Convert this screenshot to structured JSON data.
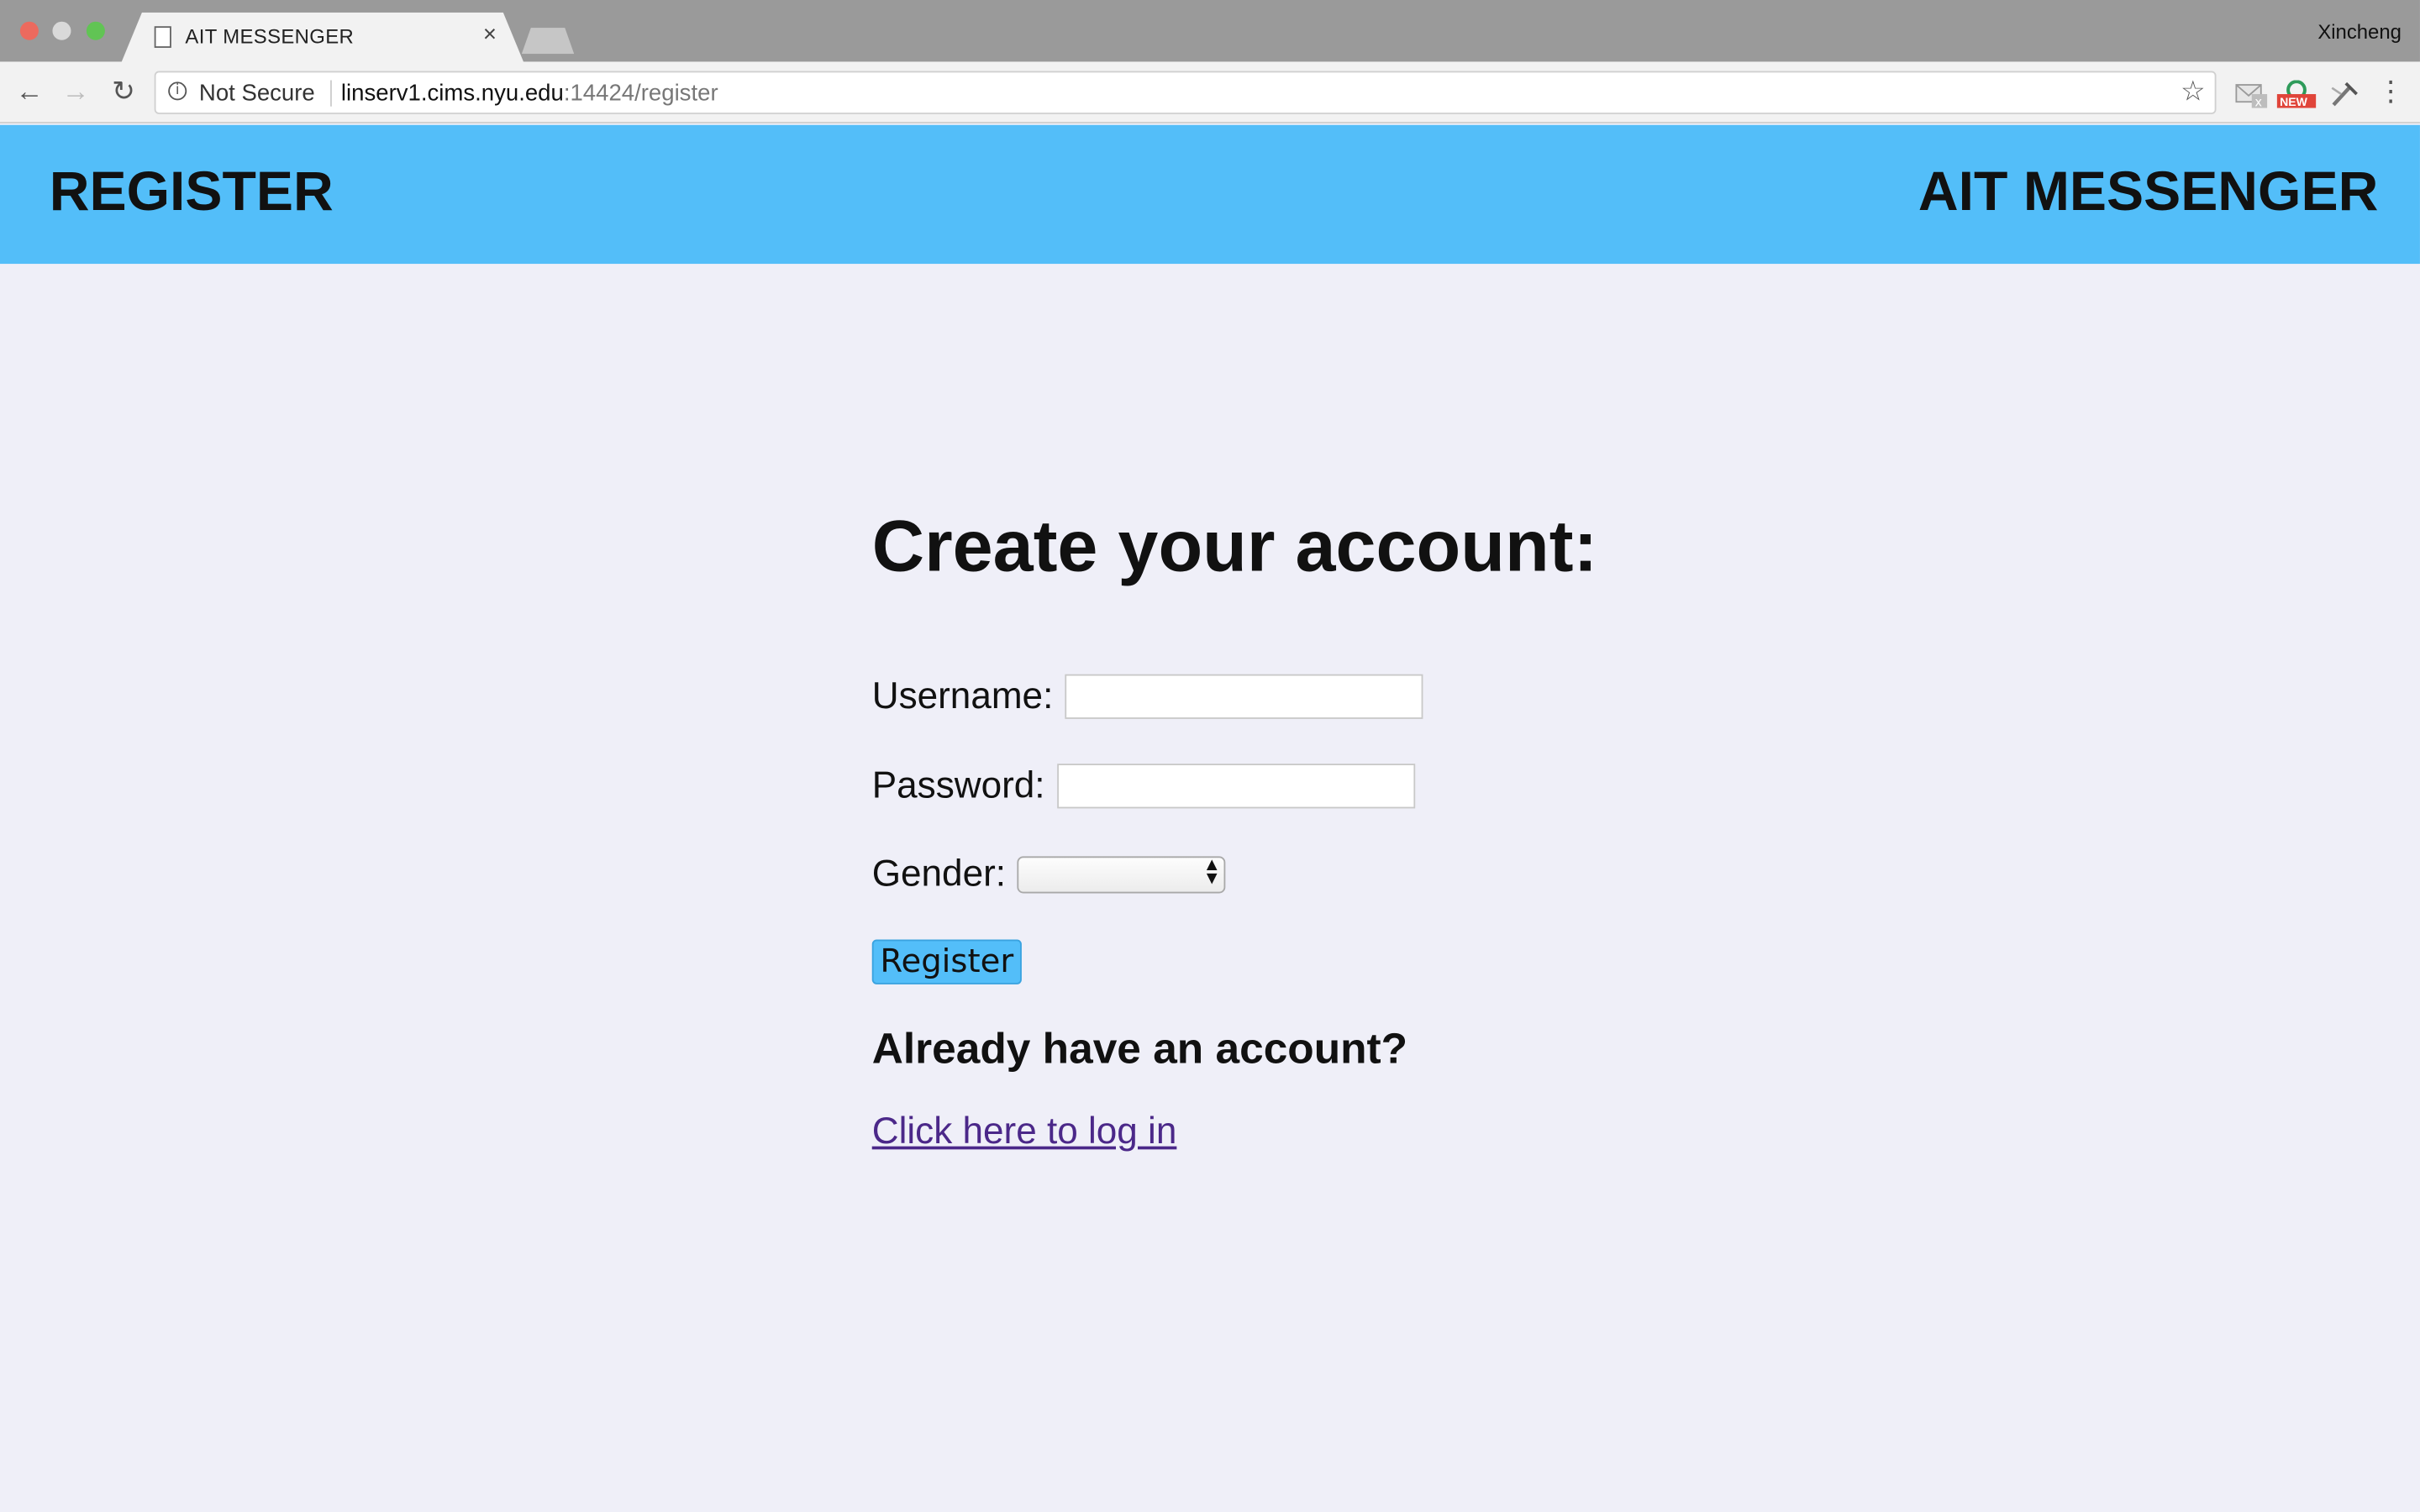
{
  "browser": {
    "tab_title": "AIT MESSENGER",
    "tab_close": "×",
    "profile_name": "Xincheng",
    "security_label": "Not Secure",
    "url_host": "linserv1.cims.nyu.edu",
    "url_rest": ":14424/register",
    "ext_new_badge": "NEW"
  },
  "header": {
    "left_title": "REGISTER",
    "right_title": "AIT MESSENGER",
    "background_color": "#53bef9"
  },
  "form": {
    "heading": "Create your account:",
    "username_label": "Username:",
    "username_value": "",
    "password_label": "Password:",
    "password_value": "",
    "gender_label": "Gender:",
    "gender_selected": "",
    "submit_label": "Register"
  },
  "login": {
    "prompt": "Already have an account?",
    "link_text": "Click here to log in"
  }
}
